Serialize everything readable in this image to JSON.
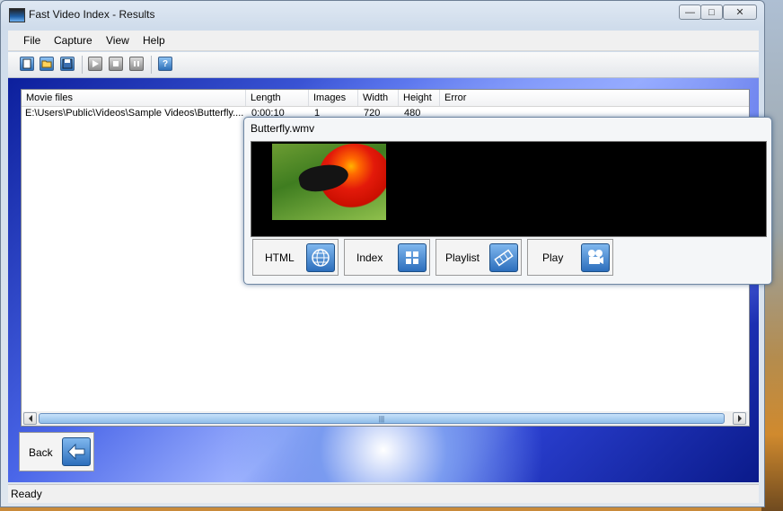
{
  "window": {
    "title": "Fast Video Index - Results",
    "controls": {
      "minimize": "—",
      "maximize": "□",
      "close": "✕"
    }
  },
  "menu": [
    "File",
    "Capture",
    "View",
    "Help"
  ],
  "toolbar": {
    "buttons": [
      "new-icon",
      "open-icon",
      "save-icon",
      "play-icon",
      "stop-icon",
      "pause-icon",
      "help-icon"
    ],
    "help_glyph": "?"
  },
  "list": {
    "columns": [
      "Movie files",
      "Length",
      "Images",
      "Width",
      "Height",
      "Error"
    ],
    "rows": [
      [
        "E:\\Users\\Public\\Videos\\Sample Videos\\Butterfly....",
        "0:00:10",
        "1",
        "720",
        "480",
        ""
      ]
    ],
    "scroll_grip": "|||"
  },
  "popup": {
    "title": "Butterfly.wmv",
    "buttons": [
      {
        "label": "HTML",
        "icon": "globe-icon"
      },
      {
        "label": "Index",
        "icon": "grid-icon"
      },
      {
        "label": "Playlist",
        "icon": "film-strip-icon"
      },
      {
        "label": "Play",
        "icon": "projector-icon"
      }
    ]
  },
  "back": {
    "label": "Back",
    "icon": "back-arrow-icon"
  },
  "status": "Ready"
}
